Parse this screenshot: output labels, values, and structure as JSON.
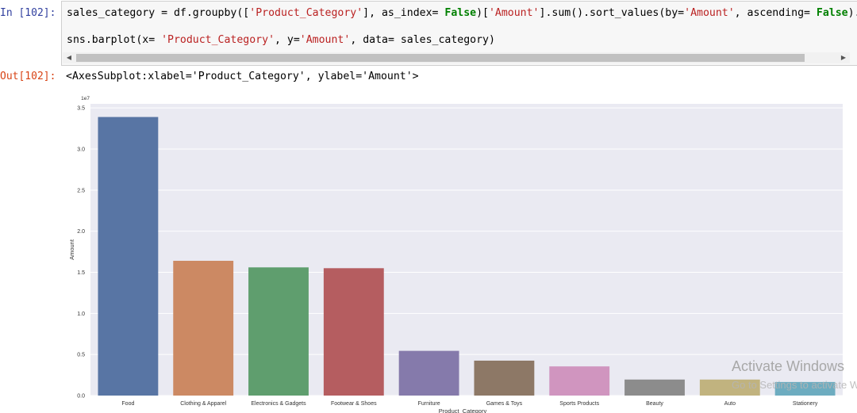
{
  "cell": {
    "in_prompt": "In [102]:",
    "out_prompt": "Out[102]:",
    "code": {
      "l1_a": "sales_category = df.groupby([",
      "l1_s1": "'Product_Category'",
      "l1_b": "], as_index= ",
      "l1_k1": "False",
      "l1_c": ")[",
      "l1_s2": "'Amount'",
      "l1_d": "].sum().sort_values(by=",
      "l1_s3": "'Amount'",
      "l1_e": ", ascending= ",
      "l1_k2": "False",
      "l1_f": ").hea",
      "l2_a": "sns.barplot(x= ",
      "l2_s1": "'Product_Category'",
      "l2_b": ", y=",
      "l2_s2": "'Amount'",
      "l2_c": ", data= sales_category)"
    },
    "scroll_left_icon": "triangle-left-icon",
    "scroll_right_icon": "triangle-right-icon",
    "output_text": "<AxesSubplot:xlabel='Product_Category', ylabel='Amount'>"
  },
  "chart_data": {
    "type": "bar",
    "categories": [
      "Food",
      "Clothing & Apparel",
      "Electronics & Gadgets",
      "Footwear & Shoes",
      "Furniture",
      "Games & Toys",
      "Sports Products",
      "Beauty",
      "Auto",
      "Stationery"
    ],
    "values": [
      33900000,
      16400000,
      15600000,
      15500000,
      5440000,
      4250000,
      3550000,
      1950000,
      1950000,
      1650000
    ],
    "colors": [
      "#5875a4",
      "#cc8963",
      "#5f9e6e",
      "#b55d60",
      "#857aab",
      "#8d7866",
      "#d095bf",
      "#8c8c8c",
      "#c1b37f",
      "#6dacc0"
    ],
    "xlabel": "Product_Category",
    "ylabel": "Amount",
    "ylim": [
      0,
      35500000
    ],
    "yticks": [
      0,
      5000000,
      10000000,
      15000000,
      20000000,
      25000000,
      30000000,
      35000000
    ],
    "ytick_labels": [
      "0.0",
      "0.5",
      "1.0",
      "1.5",
      "2.0",
      "2.5",
      "3.0",
      "3.5"
    ],
    "offset_label": "1e7",
    "grid": true,
    "background": "#eaeaf2"
  },
  "watermark": {
    "title": "Activate Windows",
    "subtitle": "Go to Settings to activate Windows."
  }
}
